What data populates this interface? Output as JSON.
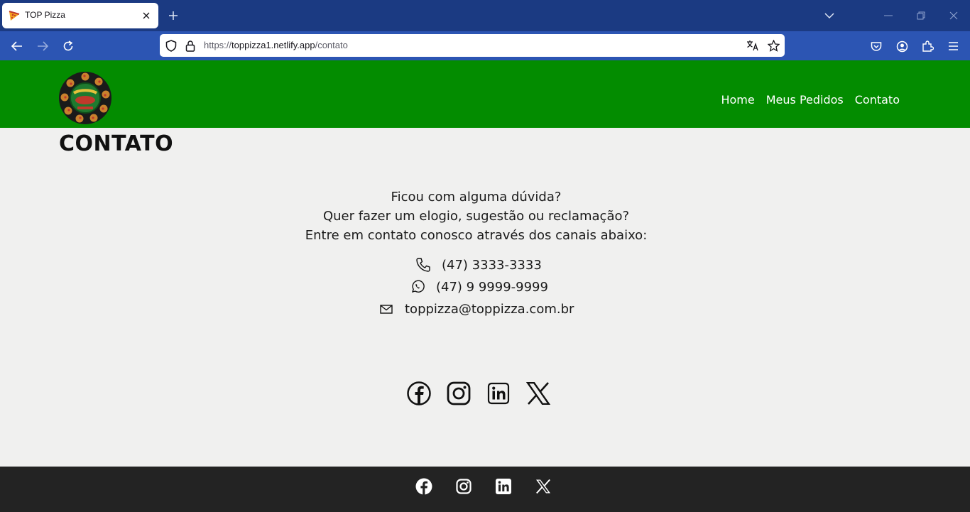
{
  "browser": {
    "tab": {
      "title": "TOP Pizza"
    },
    "url": {
      "scheme": "https://",
      "host": "toppizza1.netlify.app",
      "path": "/contato"
    }
  },
  "header": {
    "logo_alt": "TOP Pizza",
    "nav": [
      {
        "label": "Home"
      },
      {
        "label": "Meus Pedidos"
      },
      {
        "label": "Contato"
      }
    ]
  },
  "main": {
    "title": "CONTATO",
    "intro": [
      "Ficou com alguma dúvida?",
      "Quer fazer um elogio, sugestão ou reclamação?",
      "Entre em contato conosco através dos canais abaixo:"
    ],
    "contacts": [
      {
        "icon": "phone-icon",
        "value": "(47) 3333-3333"
      },
      {
        "icon": "whatsapp-icon",
        "value": "(47) 9 9999-9999"
      },
      {
        "icon": "mail-icon",
        "value": "toppizza@toppizza.com.br"
      }
    ],
    "socials": [
      "facebook-icon",
      "instagram-icon",
      "linkedin-icon",
      "x-icon"
    ]
  },
  "footer": {
    "socials": [
      "facebook-icon",
      "instagram-icon",
      "linkedin-icon",
      "x-icon"
    ]
  },
  "colors": {
    "tabbar": "#1b3a82",
    "navbar": "#2c55b3",
    "header_green": "#038c00",
    "page_bg": "#f0f0ef",
    "footer_bg": "#232323"
  }
}
